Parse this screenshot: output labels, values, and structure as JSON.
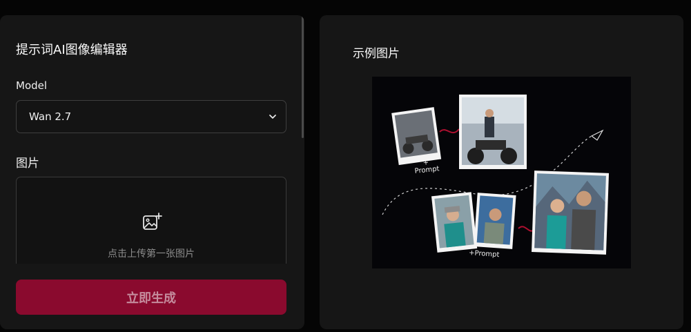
{
  "editor": {
    "title": "提示词AI图像编辑器",
    "model_label": "Model",
    "model_value": "Wan 2.7",
    "image_label": "图片",
    "upload_text": "点击上传第一张图片",
    "generate_label": "立即生成"
  },
  "example": {
    "title": "示例图片",
    "prompt_label_1": "+\nPrompt",
    "prompt_label_2": "+Prompt"
  },
  "colors": {
    "accent": "#8a0a2e",
    "panel": "#161616",
    "background": "#050505"
  }
}
